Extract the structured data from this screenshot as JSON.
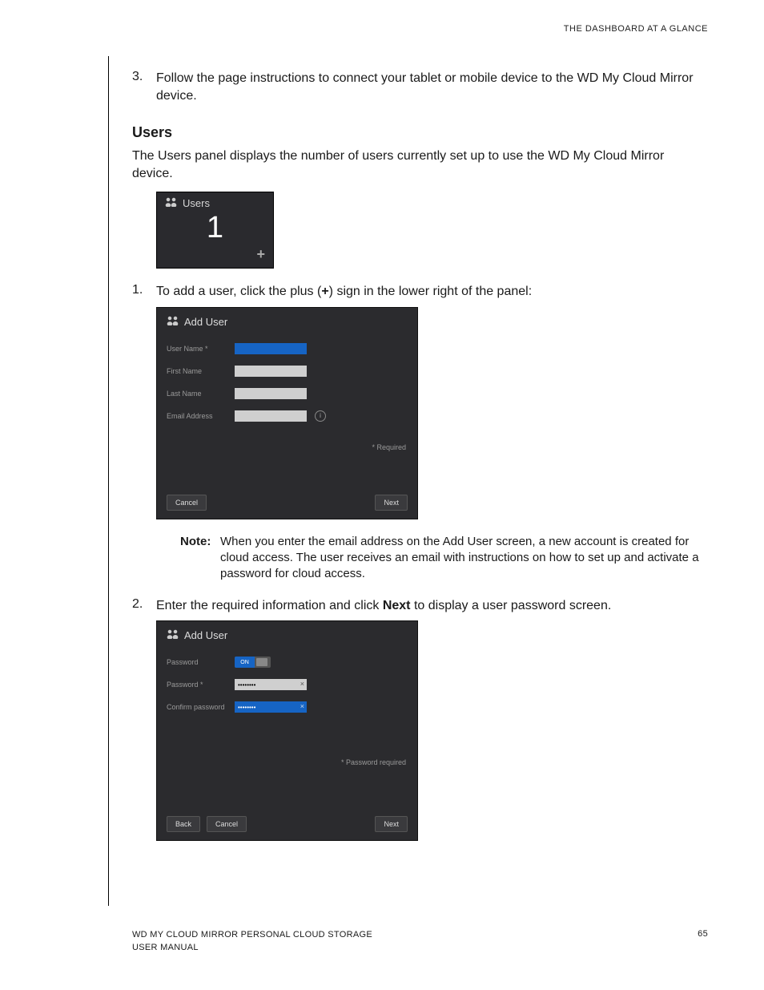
{
  "header": {
    "right": "THE DASHBOARD AT A GLANCE"
  },
  "step3": {
    "num": "3.",
    "text": "Follow the page instructions to connect your tablet or mobile device to the WD My Cloud Mirror device."
  },
  "users_heading": "Users",
  "users_intro": "The Users panel displays the number of users currently set up to use the WD My Cloud Mirror device.",
  "mini": {
    "title": "Users",
    "count": "1",
    "plus": "+"
  },
  "step1": {
    "num": "1.",
    "pre": "To add a user, click the plus (",
    "bold": "+",
    "post": ") sign in the lower right of the panel:"
  },
  "dlg1": {
    "title": "Add User",
    "username": "User Name *",
    "first": "First Name",
    "last": "Last Name",
    "email": "Email Address",
    "info": "i",
    "req": "* Required",
    "cancel": "Cancel",
    "next": "Next"
  },
  "note": {
    "label": "Note:",
    "text": "When you enter the email address on the Add User screen, a new account is created for cloud access. The user receives an email with instructions on how to set up and activate a password for cloud access."
  },
  "step2": {
    "num": "2.",
    "pre": "Enter the required information and click ",
    "bold": "Next",
    "post": " to display a user password screen."
  },
  "dlg2": {
    "title": "Add User",
    "pwd_toggle_label": "Password",
    "on": "ON",
    "pwd_label": "Password *",
    "confirm_label": "Confirm password",
    "dots": "••••••••",
    "x": "×",
    "req": "* Password required",
    "back": "Back",
    "cancel": "Cancel",
    "next": "Next"
  },
  "footer": {
    "line1": "WD MY CLOUD MIRROR PERSONAL CLOUD STORAGE",
    "line2": "USER MANUAL",
    "page": "65"
  }
}
